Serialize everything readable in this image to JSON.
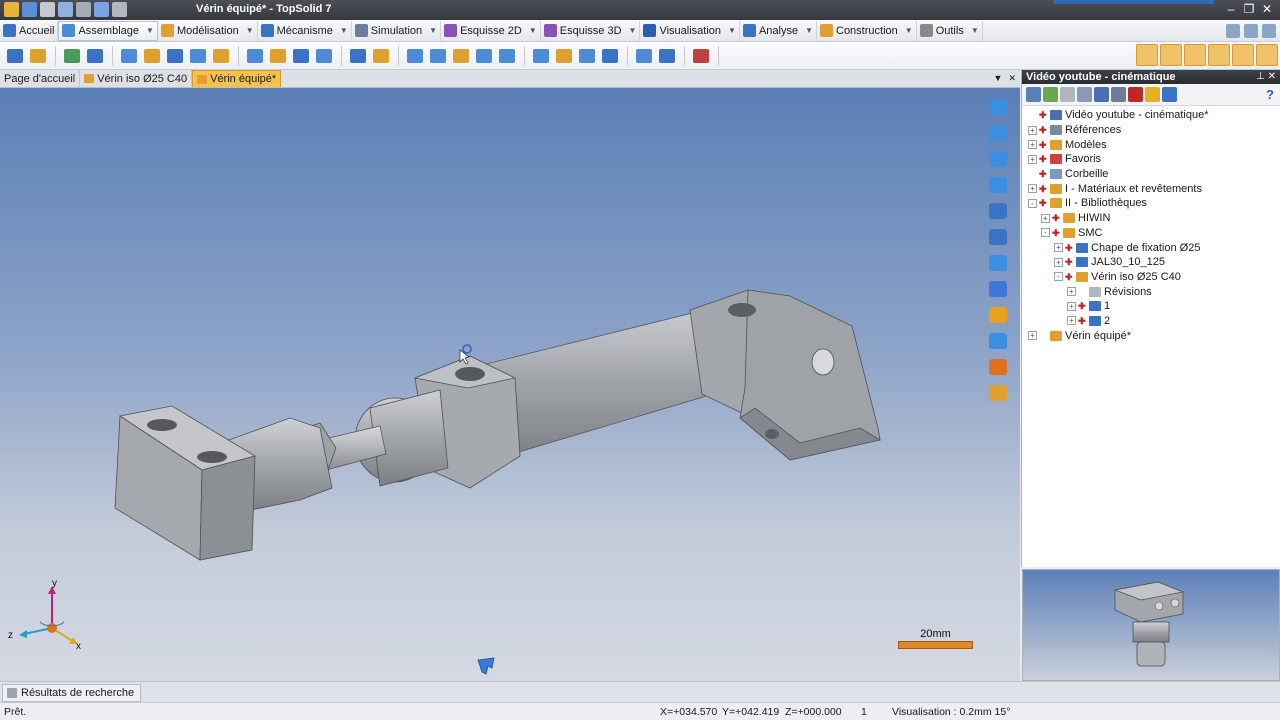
{
  "window": {
    "title": "Vérin équipé* - TopSolid 7"
  },
  "menu": [
    {
      "label": "Accueil",
      "color": "#3a72c4"
    },
    {
      "label": "Assemblage",
      "color": "#4d8bd6"
    },
    {
      "label": "Modélisation",
      "color": "#e0a030"
    },
    {
      "label": "Mécanisme",
      "color": "#3a72c4"
    },
    {
      "label": "Simulation",
      "color": "#6a7ea0"
    },
    {
      "label": "Esquisse 2D",
      "color": "#8a52b8"
    },
    {
      "label": "Esquisse 3D",
      "color": "#8a52b8"
    },
    {
      "label": "Visualisation",
      "color": "#2860b0"
    },
    {
      "label": "Analyse",
      "color": "#3a72c4"
    },
    {
      "label": "Construction",
      "color": "#e0a030"
    },
    {
      "label": "Outils",
      "color": "#888888"
    }
  ],
  "tabs": [
    {
      "label": "Page d'accueil"
    },
    {
      "label": "Vérin iso Ø25 C40"
    },
    {
      "label": "Vérin équipé*"
    }
  ],
  "panel": {
    "title": "Vidéo youtube - cinématique",
    "help": "?",
    "tree": [
      {
        "label": "Vidéo youtube - cinématique*",
        "indent": 0,
        "exp": "",
        "pin": true,
        "icon": "#4a6fb5"
      },
      {
        "label": "Références",
        "indent": 0,
        "exp": "+",
        "pin": true,
        "icon": "#7a8aa0"
      },
      {
        "label": "Modèles",
        "indent": 0,
        "exp": "+",
        "pin": true,
        "icon": "#e0a030"
      },
      {
        "label": "Favoris",
        "indent": 0,
        "exp": "+",
        "pin": true,
        "icon": "#d04040"
      },
      {
        "label": "Corbeille",
        "indent": 0,
        "exp": "",
        "pin": true,
        "icon": "#7a9ac0"
      },
      {
        "label": "I - Matériaux et revêtements",
        "indent": 0,
        "exp": "+",
        "pin": true,
        "icon": "#e0a030"
      },
      {
        "label": "II - Bibliothèques",
        "indent": 0,
        "exp": "-",
        "pin": true,
        "icon": "#e0a030"
      },
      {
        "label": "HIWIN",
        "indent": 1,
        "exp": "+",
        "pin": true,
        "icon": "#e0a030"
      },
      {
        "label": "SMC",
        "indent": 1,
        "exp": "-",
        "pin": true,
        "icon": "#e0a030"
      },
      {
        "label": "Chape de fixation Ø25",
        "indent": 2,
        "exp": "+",
        "pin": true,
        "icon": "#3a72c4"
      },
      {
        "label": "JAL30_10_125",
        "indent": 2,
        "exp": "+",
        "pin": true,
        "icon": "#3a72c4"
      },
      {
        "label": "Vérin iso Ø25 C40",
        "indent": 2,
        "exp": "-",
        "pin": true,
        "icon": "#e0a030"
      },
      {
        "label": "Révisions",
        "indent": 3,
        "exp": "+",
        "pin": false,
        "icon": "#b0b6c0"
      },
      {
        "label": "1",
        "indent": 3,
        "exp": "+",
        "pin": true,
        "icon": "#3a72c4"
      },
      {
        "label": "2",
        "indent": 3,
        "exp": "+",
        "pin": true,
        "icon": "#3a72c4"
      },
      {
        "label": "Vérin équipé*",
        "indent": 0,
        "exp": "+",
        "pin": false,
        "icon": "#e0a030"
      }
    ]
  },
  "viewport": {
    "scale_label": "20mm",
    "axes": {
      "x": "x",
      "y": "y",
      "z": "z"
    }
  },
  "bottom": {
    "search_results": "Résultats de recherche"
  },
  "status": {
    "ready": "Prêt.",
    "x": "X=+034.570",
    "y": "Y=+042.419",
    "z": "Z=+000.000",
    "count": "1",
    "visualisation": "Visualisation : 0.2mm 15°"
  }
}
